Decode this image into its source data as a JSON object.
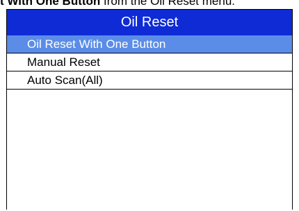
{
  "caption": {
    "bold": "t With One Button",
    "rest": " from the Oil Reset menu."
  },
  "header": {
    "title": "Oil Reset"
  },
  "menu": {
    "items": [
      {
        "label": "Oil Reset With One Button",
        "selected": true
      },
      {
        "label": "Manual Reset",
        "selected": false
      },
      {
        "label": "Auto Scan(All)",
        "selected": false
      }
    ]
  },
  "colors": {
    "title_bar": "#0e2bd6",
    "selected_row": "#5b8de8"
  }
}
